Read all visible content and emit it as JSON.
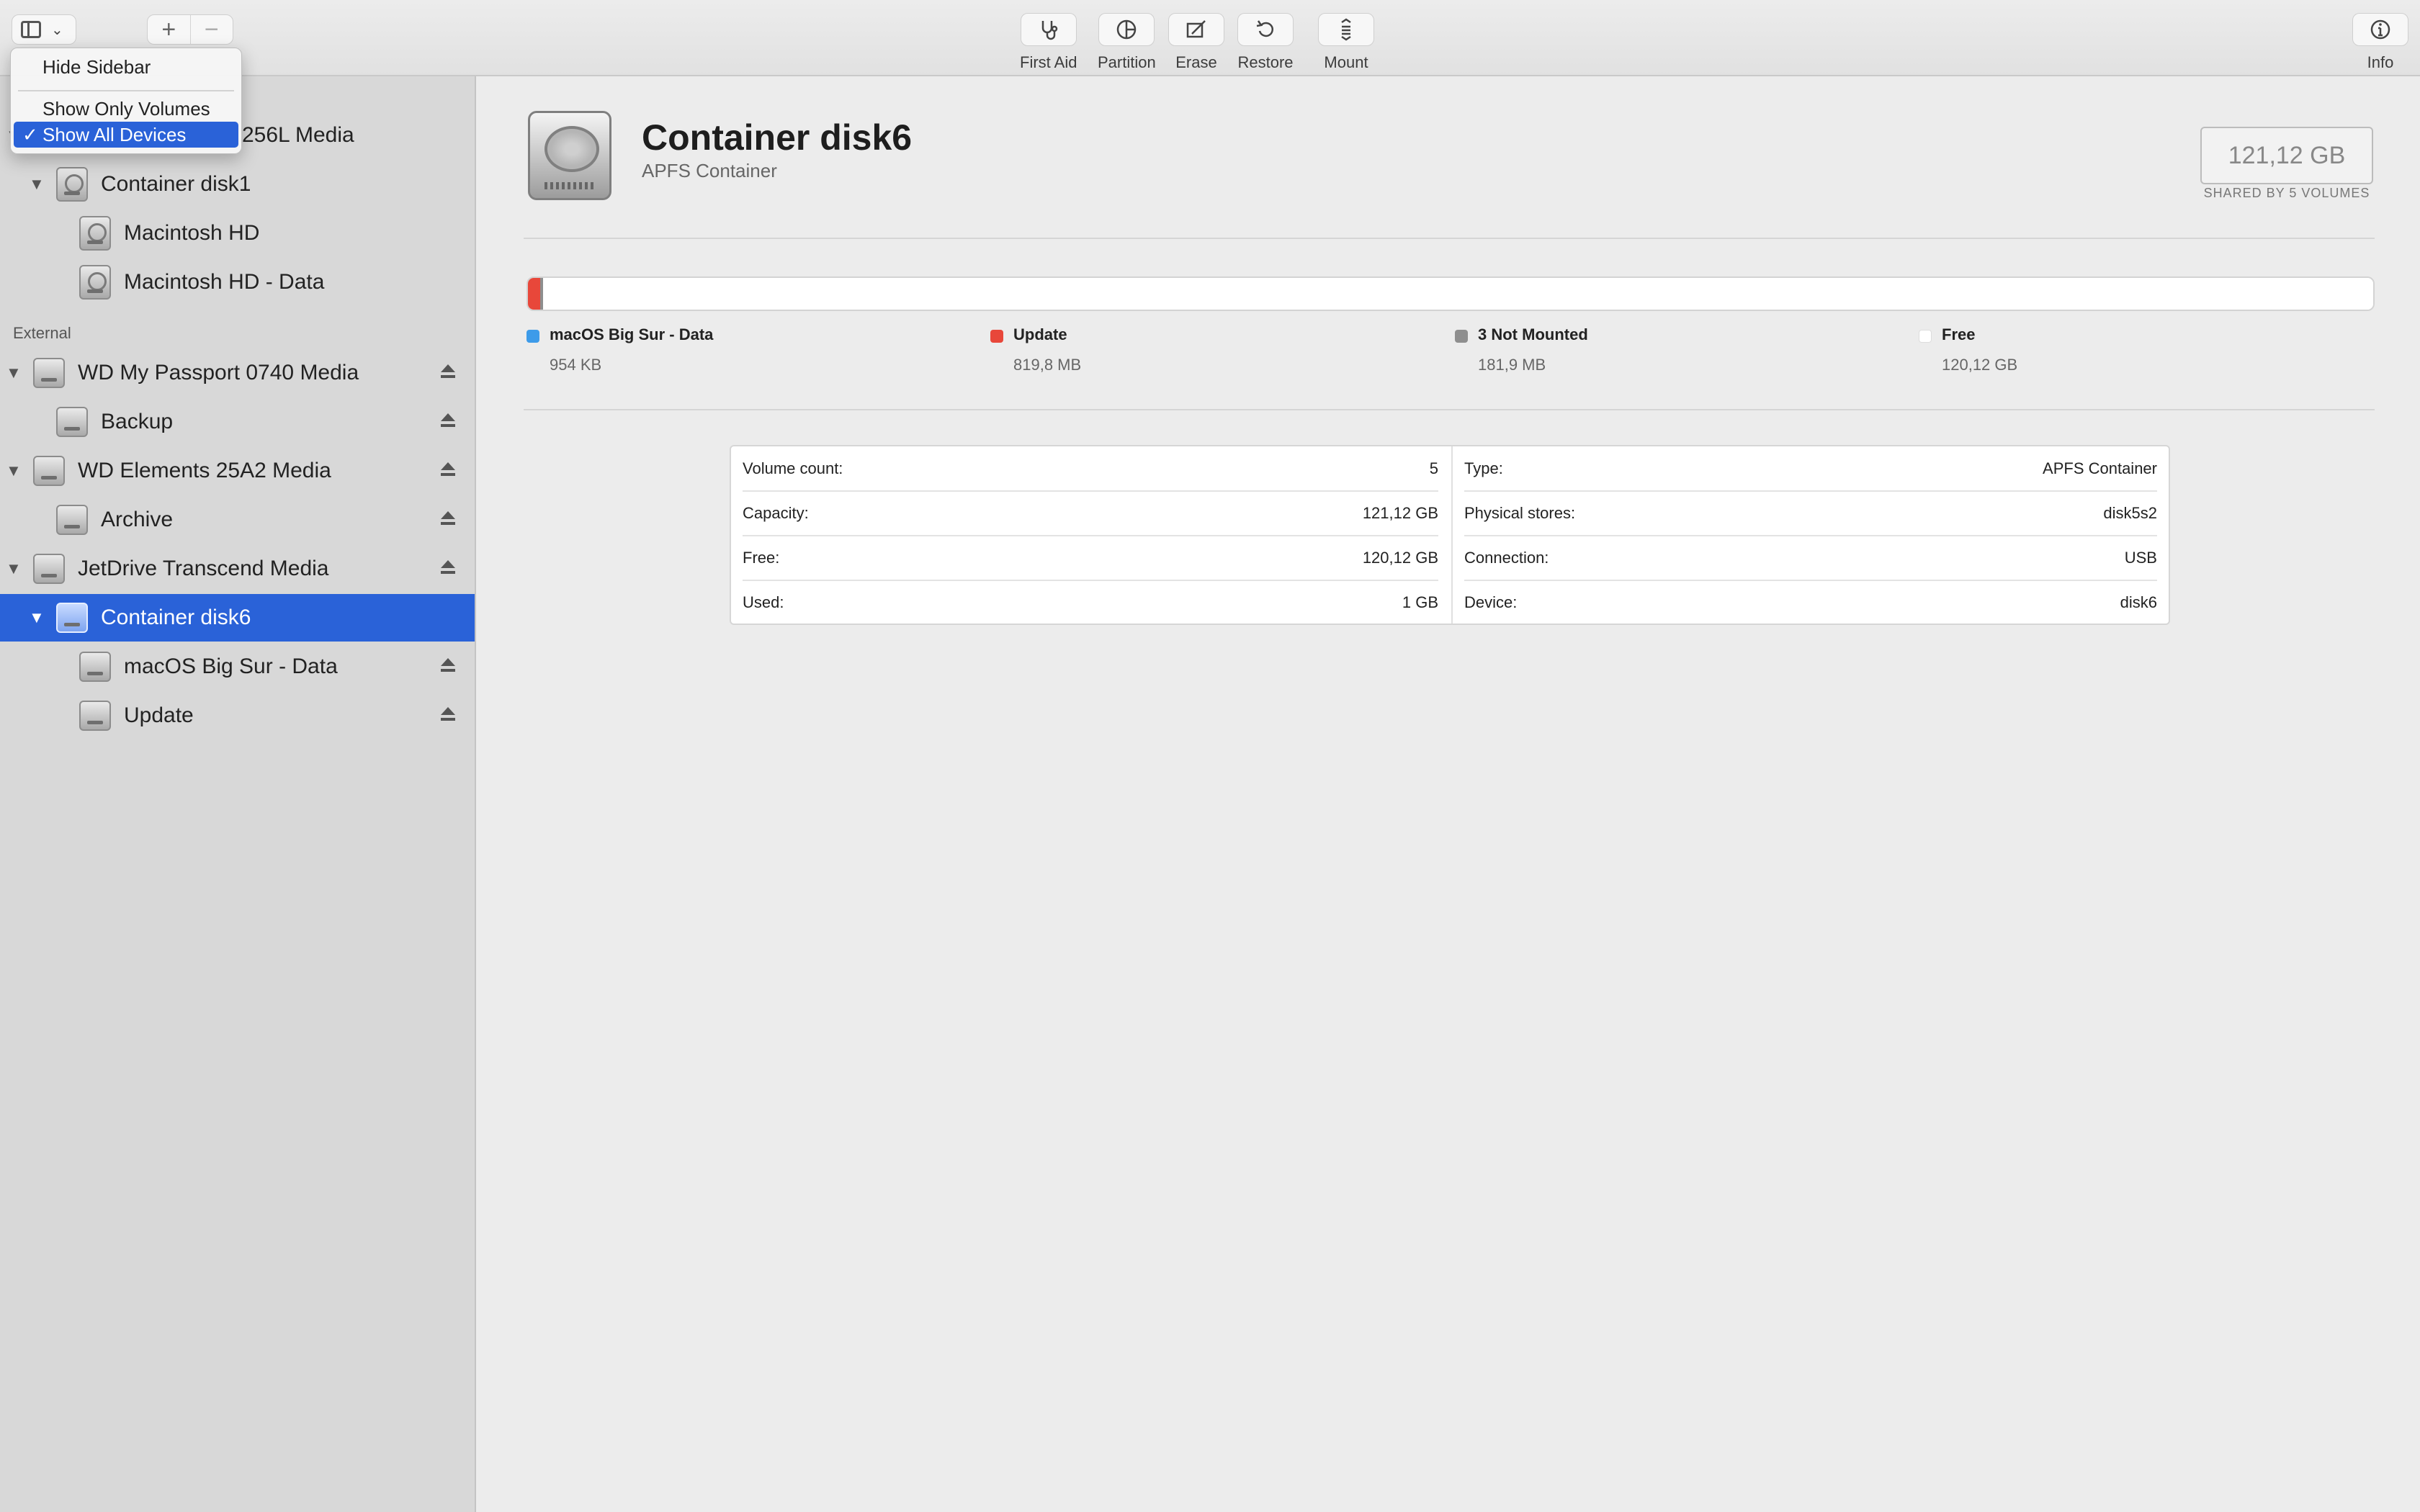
{
  "toolbar": {
    "buttons": [
      {
        "label": "First Aid",
        "icon": "stethoscope-icon"
      },
      {
        "label": "Partition",
        "icon": "pie-icon"
      },
      {
        "label": "Erase",
        "icon": "erase-icon"
      },
      {
        "label": "Restore",
        "icon": "restore-icon"
      },
      {
        "label": "Mount",
        "icon": "mount-icon"
      }
    ],
    "info_label": "Info",
    "plus": "+",
    "minus": "−"
  },
  "menu": {
    "items": [
      {
        "label": "Hide Sidebar"
      },
      {
        "label": "Show Only Volumes"
      },
      {
        "label": "Show All Devices",
        "checked": true
      }
    ],
    "check": "✓"
  },
  "sidebar": {
    "partial_top_item": "256L Media",
    "external_label": "External",
    "items": [
      {
        "label": "Container disk1"
      },
      {
        "label": "Macintosh HD"
      },
      {
        "label": "Macintosh HD - Data"
      },
      {
        "label": "WD My Passport 0740 Media"
      },
      {
        "label": "Backup"
      },
      {
        "label": "WD Elements 25A2 Media"
      },
      {
        "label": "Archive"
      },
      {
        "label": "JetDrive Transcend Media"
      },
      {
        "label": "Container disk6",
        "selected": true
      },
      {
        "label": "macOS Big Sur - Data"
      },
      {
        "label": "Update"
      }
    ]
  },
  "main": {
    "title": "Container disk6",
    "subtitle": "APFS Container",
    "capacity": "121,12 GB",
    "capacity_sub": "SHARED BY 5 VOLUMES",
    "legend": [
      {
        "name": "macOS Big Sur - Data",
        "value": "954 KB",
        "color": "#3d9be9",
        "fraction": 0.0
      },
      {
        "name": "Update",
        "value": "819,8 MB",
        "color": "#e8473a",
        "fraction": 0.0068
      },
      {
        "name": "3 Not Mounted",
        "value": "181,9 MB",
        "color": "#8e8e8e",
        "fraction": 0.0015
      },
      {
        "name": "Free",
        "value": "120,12 GB",
        "color": "#ffffff",
        "fraction": 0.9917
      }
    ],
    "details_left": [
      {
        "label": "Volume count:",
        "value": "5"
      },
      {
        "label": "Capacity:",
        "value": "121,12 GB"
      },
      {
        "label": "Free:",
        "value": "120,12 GB"
      },
      {
        "label": "Used:",
        "value": "1 GB"
      }
    ],
    "details_right": [
      {
        "label": "Type:",
        "value": "APFS Container"
      },
      {
        "label": "Physical stores:",
        "value": "disk5s2"
      },
      {
        "label": "Connection:",
        "value": "USB"
      },
      {
        "label": "Device:",
        "value": "disk6"
      }
    ]
  }
}
